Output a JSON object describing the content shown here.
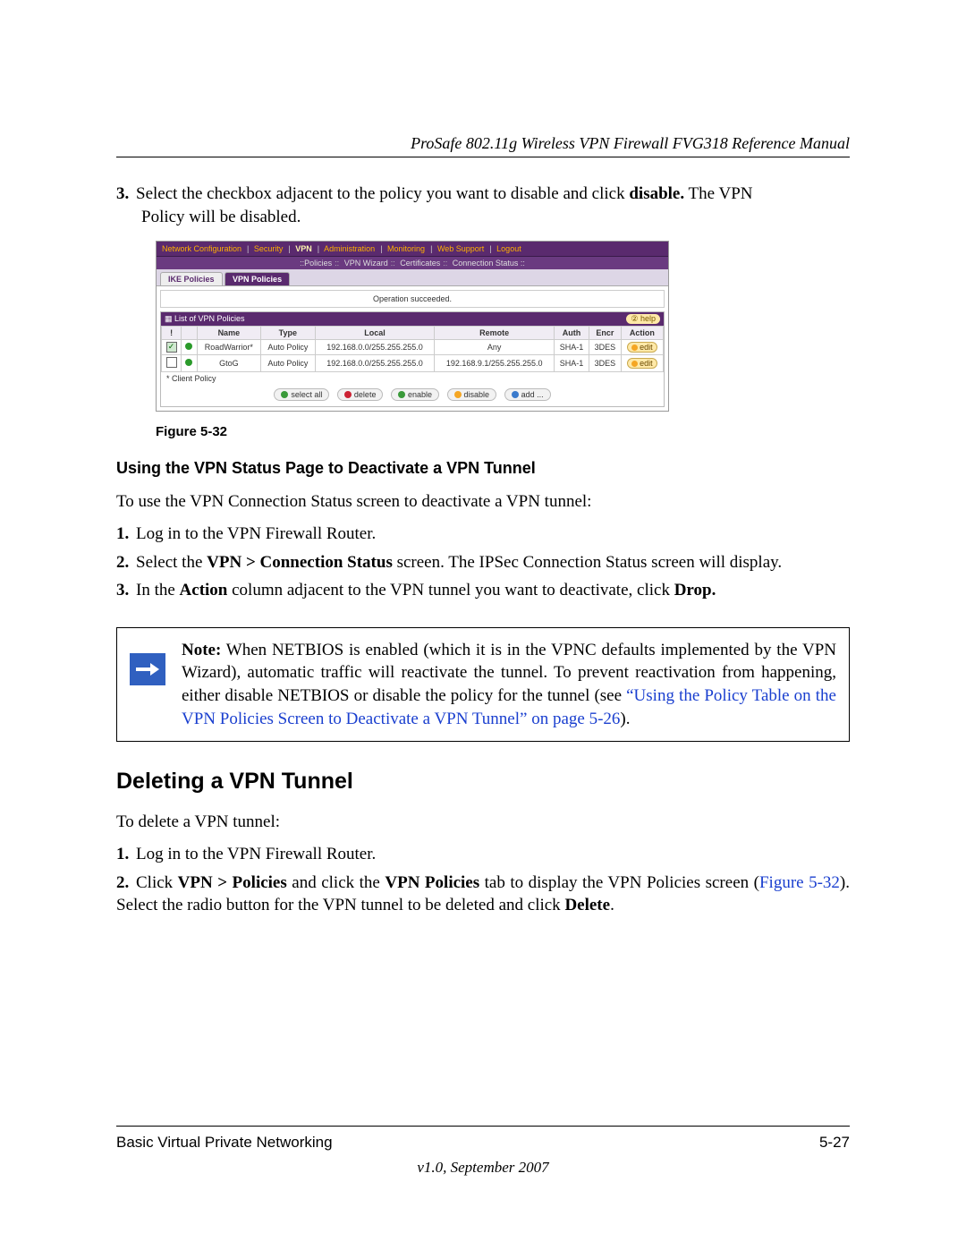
{
  "header": {
    "title": "ProSafe 802.11g Wireless VPN Firewall FVG318 Reference Manual"
  },
  "step3": {
    "num": "3.",
    "pre": "Select the checkbox adjacent to the policy you want to disable and click ",
    "bold": "disable.",
    "post1": " The VPN",
    "post2": "Policy will be disabled."
  },
  "figure": {
    "nav1": {
      "items": [
        "Network Configuration",
        "Security",
        "VPN",
        "Administration",
        "Monitoring",
        "Web Support",
        "Logout"
      ]
    },
    "nav2": {
      "items": [
        "Policies",
        "VPN Wizard",
        "Certificates",
        "Connection Status"
      ]
    },
    "tabs": {
      "ike": "IKE Policies",
      "vpn": "VPN Policies"
    },
    "opmsg": "Operation succeeded.",
    "panel_title": "List of VPN Policies",
    "help": "help",
    "cols": {
      "chk": "!",
      "status": "",
      "name": "Name",
      "type": "Type",
      "local": "Local",
      "remote": "Remote",
      "auth": "Auth",
      "encr": "Encr",
      "action": "Action"
    },
    "rows": [
      {
        "checked": true,
        "name": "RoadWarrior*",
        "type": "Auto Policy",
        "local": "192.168.0.0/255.255.255.0",
        "remote": "Any",
        "auth": "SHA-1",
        "encr": "3DES",
        "action": "edit"
      },
      {
        "checked": false,
        "name": "GtoG",
        "type": "Auto Policy",
        "local": "192.168.0.0/255.255.255.0",
        "remote": "192.168.9.1/255.255.255.0",
        "auth": "SHA-1",
        "encr": "3DES",
        "action": "edit"
      }
    ],
    "footnote": "* Client Policy",
    "buttons": {
      "selectall": "select all",
      "delete": "delete",
      "enable": "enable",
      "disable": "disable",
      "add": "add ..."
    },
    "caption": "Figure 5-32"
  },
  "subheading": "Using the VPN Status Page to Deactivate a VPN Tunnel",
  "intro2": "To use the VPN Connection Status screen to deactivate a VPN tunnel:",
  "list2": {
    "i1": {
      "num": "1.",
      "text": "Log in to the VPN Firewall Router."
    },
    "i2": {
      "num": "2.",
      "pre": "Select the ",
      "b": "VPN > Connection Status",
      "post": " screen. The IPSec Connection Status screen will display."
    },
    "i3": {
      "num": "3.",
      "pre": "In the ",
      "b1": "Action",
      "mid": " column adjacent to the VPN tunnel you want to deactivate, click ",
      "b2": "Drop."
    }
  },
  "note": {
    "label": "Note:",
    "t1": " When NETBIOS is enabled (which it is in the VPNC defaults implemented by the VPN Wizard), automatic traffic will reactivate the tunnel. To prevent reactivation from happening, either disable NETBIOS or disable the policy for the tunnel (see ",
    "link": "“Using the Policy Table on the VPN Policies Screen to Deactivate a VPN Tunnel” on page 5-26",
    "t2": ")."
  },
  "heading2": "Deleting a VPN Tunnel",
  "intro3": "To delete a VPN tunnel:",
  "list3": {
    "i1": {
      "num": "1.",
      "text": "Log in to the VPN Firewall Router."
    },
    "i2": {
      "num": "2.",
      "pre": "Click ",
      "b1": "VPN > Policies",
      "mid1": " and click the ",
      "b2": "VPN Policies",
      "mid2": " tab to display the VPN Policies screen (",
      "link": "Figure 5-32",
      "mid3": "). Select the radio button for the VPN tunnel to be deleted and click ",
      "b3": "Delete",
      "post": "."
    }
  },
  "footer": {
    "left": "Basic Virtual Private Networking",
    "right": "5-27",
    "version": "v1.0, September 2007"
  }
}
